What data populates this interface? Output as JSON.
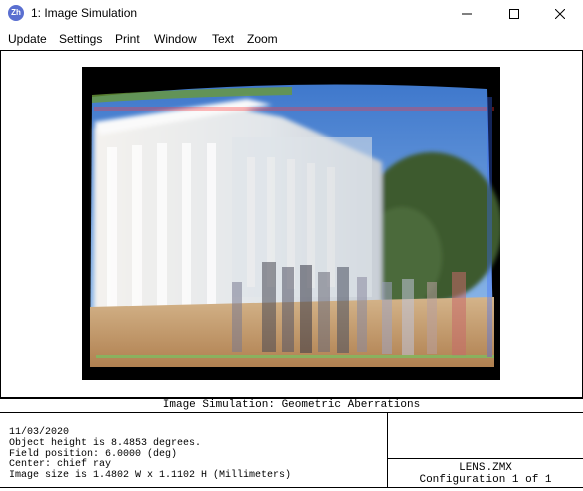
{
  "window": {
    "icon_text": "Zh",
    "title": "1: Image Simulation"
  },
  "menu": {
    "items": [
      "Update",
      "Settings",
      "Print",
      "Window",
      "Text",
      "Zoom"
    ]
  },
  "plot": {
    "title": "Image Simulation: Geometric Aberrations",
    "info_lines": [
      "11/03/2020",
      "Object height is 8.4853 degrees.",
      "Field position: 6.0000 (deg)",
      "Center: chief ray",
      "Image size is 1.4802 W x 1.1102 H (Millimeters)"
    ],
    "file_name": "LENS.ZMX",
    "configuration": "Configuration 1 of 1"
  },
  "colors": {
    "sky": "#5c8fd6",
    "building": "#e8ecf0",
    "ground": "#c8a070",
    "trees": "#3d5a2e",
    "border": "#000000"
  },
  "icons": {
    "app": "zemax-app-icon",
    "minimize": "minimize-icon",
    "maximize": "maximize-icon",
    "close": "close-icon"
  }
}
